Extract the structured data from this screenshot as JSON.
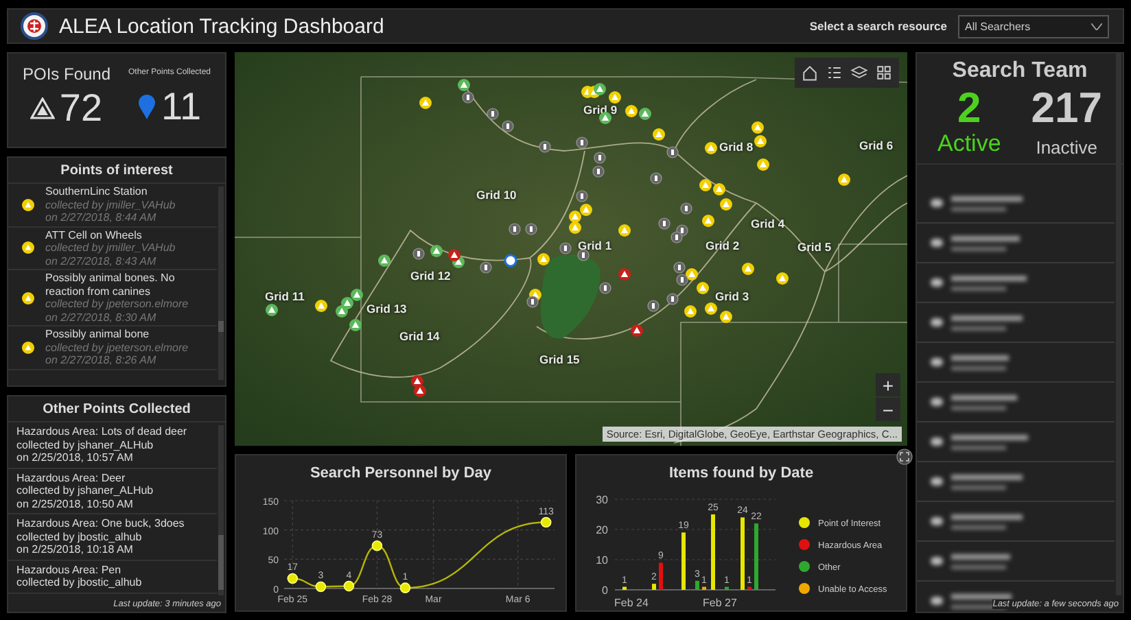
{
  "header": {
    "title": "ALEA Location Tracking Dashboard",
    "resource_label": "Select a search resource",
    "resource_select": {
      "value": "All Searchers"
    }
  },
  "pois_card": {
    "title": "POIs Found",
    "count": "72",
    "other_label": "Other Points Collected",
    "other_count": "11"
  },
  "points_of_interest": {
    "title": "Points of interest",
    "items": [
      {
        "name": "SouthernLinc Station",
        "collected_by": "collected by jmiller_VAHub",
        "date": "on 2/27/2018, 8:44 AM"
      },
      {
        "name": "ATT Cell on Wheels",
        "collected_by": "collected by jmiller_VAHub",
        "date": "on 2/27/2018, 8:43 AM"
      },
      {
        "name": "Possibly animal bones. No reaction from canines",
        "collected_by": "collected by jpeterson.elmore",
        "date": "on 2/27/2018, 8:30 AM"
      },
      {
        "name": "Possibly animal bone",
        "collected_by": "collected by jpeterson.elmore",
        "date": "on 2/27/2018, 8:26 AM"
      }
    ]
  },
  "other_points": {
    "title": "Other Points Collected",
    "items": [
      {
        "lines": [
          "Hazardous Area: Lots of dead deer",
          "collected by jshaner_ALHub",
          "on 2/25/2018, 10:57 AM"
        ]
      },
      {
        "lines": [
          "Hazardous Area: Deer",
          "collected by jshaner_ALHub",
          "on 2/25/2018, 10:50 AM"
        ]
      },
      {
        "lines": [
          "Hazardous Area: One buck, 3does",
          "collected by jbostic_alhub",
          "on 2/25/2018, 10:18 AM"
        ]
      },
      {
        "lines": [
          "Hazardous Area: Pen",
          "collected by jbostic_alhub"
        ]
      }
    ],
    "last_update": "Last update: 3 minutes ago"
  },
  "map": {
    "grid_labels": [
      "Grid 9",
      "Grid 8",
      "Grid 6",
      "Grid 10",
      "Grid 4",
      "Grid 1",
      "Grid 2",
      "Grid 5",
      "Grid 12",
      "Grid 11",
      "Grid 3",
      "Grid 13",
      "Grid 14",
      "Grid 15"
    ],
    "zoom_in": "+",
    "zoom_out": "−",
    "attribution": "Source: Esri, DigitalGlobe, GeoEye, Earthstar Geographics, C..."
  },
  "personnel_chart": {
    "chart_data": {
      "type": "line",
      "title": "Search Personnel by Day",
      "categories": [
        "Feb 25",
        null,
        null,
        "Feb 28",
        null,
        "Mar",
        null,
        null,
        "Mar 6",
        null
      ],
      "series": [
        {
          "color": "#e8e800",
          "marker": "circle",
          "values": [
            17,
            3,
            4,
            73,
            1,
            null,
            null,
            null,
            null,
            113
          ]
        }
      ],
      "ylim": [
        0,
        150
      ],
      "grid": true,
      "yticks": [
        0,
        50,
        100,
        150
      ],
      "data_labels": true
    }
  },
  "items_chart": {
    "chart_data": {
      "type": "bar",
      "title": "Items found by Date",
      "series": [
        {
          "name": "Point of Interest",
          "color": "#e6e600",
          "values": [
            1,
            2,
            19,
            25,
            24
          ]
        },
        {
          "name": "Hazardous Area",
          "color": "#e01010",
          "values": [
            null,
            9,
            null,
            null,
            1
          ]
        },
        {
          "name": "Other",
          "color": "#2ea82e",
          "values": [
            null,
            null,
            3,
            1,
            22
          ]
        },
        {
          "name": "Unable to Access",
          "color": "#f0a800",
          "values": [
            null,
            null,
            1,
            null,
            null
          ]
        }
      ],
      "categories": [
        "Feb 24",
        null,
        null,
        "Feb 27",
        null
      ],
      "ylim": [
        0,
        30
      ],
      "yticks": [
        0,
        10,
        20,
        30
      ],
      "legend": true,
      "data_labels": true
    }
  },
  "search_team": {
    "title": "Search Team",
    "active_count": "2",
    "active_label": "Active",
    "inactive_count": "217",
    "inactive_label": "Inactive",
    "last_update": "Last update: a few seconds ago"
  }
}
